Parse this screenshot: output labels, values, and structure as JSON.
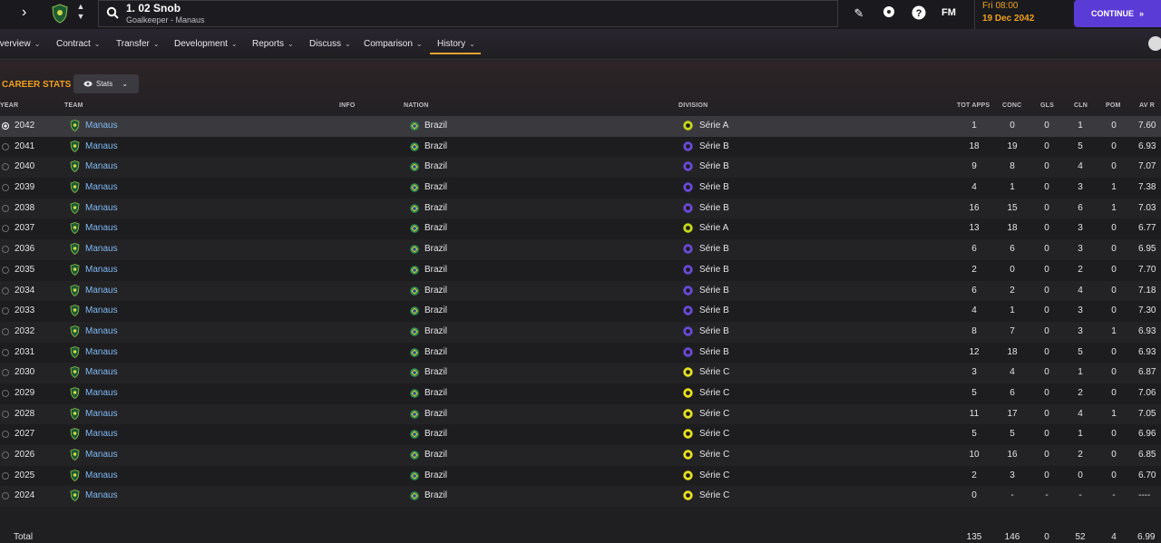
{
  "header": {
    "player_name": "1. 02 Snob",
    "player_sub": "Goalkeeper - Manaus",
    "fm_label": "FM",
    "date_time": "Fri 08:00",
    "date_day": "19 Dec 2042",
    "continue_label": "CONTINUE"
  },
  "tabs": [
    {
      "label": "Overview",
      "chev": "⌄"
    },
    {
      "label": "Contract",
      "chev": "⌄"
    },
    {
      "label": "Transfer",
      "chev": "⌄"
    },
    {
      "label": "Development",
      "chev": "⌄"
    },
    {
      "label": "Reports",
      "chev": "⌄"
    },
    {
      "label": "Discuss",
      "chev": "⌄"
    },
    {
      "label": "Comparison",
      "chev": "⌄"
    },
    {
      "label": "History",
      "chev": "⌄"
    }
  ],
  "section": {
    "title": "CAREER STATS",
    "dropdown_label": "Stats"
  },
  "columns": {
    "year": "YEAR",
    "team": "TEAM",
    "info": "INFO",
    "nation": "NATION",
    "division": "DIVISION",
    "apps": "TOT APPS",
    "conc": "CONC",
    "gls": "GLS",
    "cln": "CLN",
    "pom": "POM",
    "avr": "AV R"
  },
  "colors": {
    "accent": "#f0a020",
    "link": "#7fb8f0",
    "continue": "#5b3bd6",
    "serie_a": "#c8d818",
    "serie_b": "#6a4ad8",
    "serie_c": "#e8e020"
  },
  "rows": [
    {
      "year": "2042",
      "team": "Manaus",
      "nation": "Brazil",
      "division": "Série A",
      "apps": "1",
      "conc": "0",
      "gls": "0",
      "cln": "1",
      "pom": "0",
      "avr": "7.60"
    },
    {
      "year": "2041",
      "team": "Manaus",
      "nation": "Brazil",
      "division": "Série B",
      "apps": "18",
      "conc": "19",
      "gls": "0",
      "cln": "5",
      "pom": "0",
      "avr": "6.93"
    },
    {
      "year": "2040",
      "team": "Manaus",
      "nation": "Brazil",
      "division": "Série B",
      "apps": "9",
      "conc": "8",
      "gls": "0",
      "cln": "4",
      "pom": "0",
      "avr": "7.07"
    },
    {
      "year": "2039",
      "team": "Manaus",
      "nation": "Brazil",
      "division": "Série B",
      "apps": "4",
      "conc": "1",
      "gls": "0",
      "cln": "3",
      "pom": "1",
      "avr": "7.38"
    },
    {
      "year": "2038",
      "team": "Manaus",
      "nation": "Brazil",
      "division": "Série B",
      "apps": "16",
      "conc": "15",
      "gls": "0",
      "cln": "6",
      "pom": "1",
      "avr": "7.03"
    },
    {
      "year": "2037",
      "team": "Manaus",
      "nation": "Brazil",
      "division": "Série A",
      "apps": "13",
      "conc": "18",
      "gls": "0",
      "cln": "3",
      "pom": "0",
      "avr": "6.77"
    },
    {
      "year": "2036",
      "team": "Manaus",
      "nation": "Brazil",
      "division": "Série B",
      "apps": "6",
      "conc": "6",
      "gls": "0",
      "cln": "3",
      "pom": "0",
      "avr": "6.95"
    },
    {
      "year": "2035",
      "team": "Manaus",
      "nation": "Brazil",
      "division": "Série B",
      "apps": "2",
      "conc": "0",
      "gls": "0",
      "cln": "2",
      "pom": "0",
      "avr": "7.70"
    },
    {
      "year": "2034",
      "team": "Manaus",
      "nation": "Brazil",
      "division": "Série B",
      "apps": "6",
      "conc": "2",
      "gls": "0",
      "cln": "4",
      "pom": "0",
      "avr": "7.18"
    },
    {
      "year": "2033",
      "team": "Manaus",
      "nation": "Brazil",
      "division": "Série B",
      "apps": "4",
      "conc": "1",
      "gls": "0",
      "cln": "3",
      "pom": "0",
      "avr": "7.30"
    },
    {
      "year": "2032",
      "team": "Manaus",
      "nation": "Brazil",
      "division": "Série B",
      "apps": "8",
      "conc": "7",
      "gls": "0",
      "cln": "3",
      "pom": "1",
      "avr": "6.93"
    },
    {
      "year": "2031",
      "team": "Manaus",
      "nation": "Brazil",
      "division": "Série B",
      "apps": "12",
      "conc": "18",
      "gls": "0",
      "cln": "5",
      "pom": "0",
      "avr": "6.93"
    },
    {
      "year": "2030",
      "team": "Manaus",
      "nation": "Brazil",
      "division": "Série C",
      "apps": "3",
      "conc": "4",
      "gls": "0",
      "cln": "1",
      "pom": "0",
      "avr": "6.87"
    },
    {
      "year": "2029",
      "team": "Manaus",
      "nation": "Brazil",
      "division": "Série C",
      "apps": "5",
      "conc": "6",
      "gls": "0",
      "cln": "2",
      "pom": "0",
      "avr": "7.06"
    },
    {
      "year": "2028",
      "team": "Manaus",
      "nation": "Brazil",
      "division": "Série C",
      "apps": "11",
      "conc": "17",
      "gls": "0",
      "cln": "4",
      "pom": "1",
      "avr": "7.05"
    },
    {
      "year": "2027",
      "team": "Manaus",
      "nation": "Brazil",
      "division": "Série C",
      "apps": "5",
      "conc": "5",
      "gls": "0",
      "cln": "1",
      "pom": "0",
      "avr": "6.96"
    },
    {
      "year": "2026",
      "team": "Manaus",
      "nation": "Brazil",
      "division": "Série C",
      "apps": "10",
      "conc": "16",
      "gls": "0",
      "cln": "2",
      "pom": "0",
      "avr": "6.85"
    },
    {
      "year": "2025",
      "team": "Manaus",
      "nation": "Brazil",
      "division": "Série C",
      "apps": "2",
      "conc": "3",
      "gls": "0",
      "cln": "0",
      "pom": "0",
      "avr": "6.70"
    },
    {
      "year": "2024",
      "team": "Manaus",
      "nation": "Brazil",
      "division": "Série C",
      "apps": "0",
      "conc": "-",
      "gls": "-",
      "cln": "-",
      "pom": "-",
      "avr": "----"
    }
  ],
  "total": {
    "label": "Total",
    "apps": "135",
    "conc": "146",
    "gls": "0",
    "cln": "52",
    "pom": "4",
    "avr": "6.99"
  }
}
